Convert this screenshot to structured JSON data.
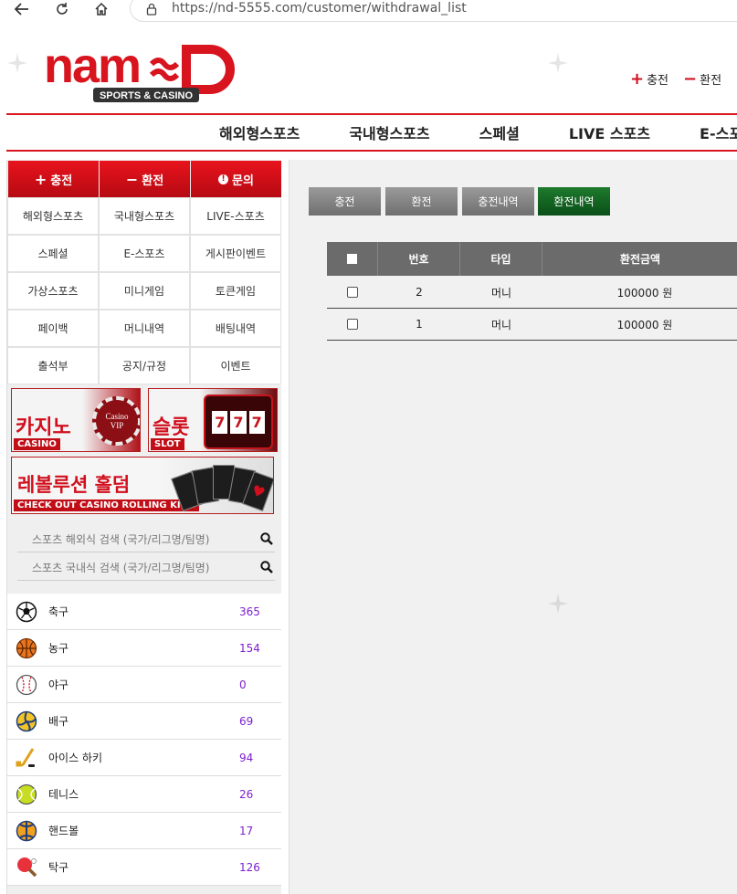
{
  "browser": {
    "url": "https://nd-5555.com/customer/withdrawal_list"
  },
  "header": {
    "logo_text": "nam⌁D",
    "logo_sub": "SPORTS & CASINO",
    "charge_link": "충전",
    "exchange_link": "환전",
    "nav": [
      "해외형스포츠",
      "국내형스포츠",
      "스페셜",
      "LIVE 스포츠",
      "E-스포츠"
    ]
  },
  "sidebar": {
    "quick": [
      {
        "icon": "plus-icon",
        "label": "충전"
      },
      {
        "icon": "minus-icon",
        "label": "환전"
      },
      {
        "icon": "info-icon",
        "label": "문의"
      }
    ],
    "menu": [
      "해외형스포츠",
      "국내형스포츠",
      "LIVE-스포츠",
      "스페셜",
      "E-스포츠",
      "게시판이벤트",
      "가상스포츠",
      "미니게임",
      "토큰게임",
      "페이백",
      "머니내역",
      "배팅내역",
      "출석부",
      "공지/규정",
      "이벤트"
    ],
    "banners": {
      "casino": {
        "title": "카지노",
        "sub": "CASINO",
        "badge": "Casino VIP"
      },
      "slot": {
        "title": "슬롯",
        "sub": "SLOT"
      },
      "holdem": {
        "title": "레볼루션 홀덤",
        "sub": "CHECK OUT CASINO ROLLING KING"
      }
    },
    "search": [
      {
        "placeholder": "스포츠 해외식 검색 (국가/리그명/팀명)"
      },
      {
        "placeholder": "스포츠 국내식 검색 (국가/리그명/팀명)"
      }
    ],
    "sports": [
      {
        "icon": "soccer-icon",
        "name": "축구",
        "count": "365"
      },
      {
        "icon": "basketball-icon",
        "name": "농구",
        "count": "154"
      },
      {
        "icon": "baseball-icon",
        "name": "야구",
        "count": "0"
      },
      {
        "icon": "volleyball-icon",
        "name": "배구",
        "count": "69"
      },
      {
        "icon": "hockey-icon",
        "name": "아이스 하키",
        "count": "94"
      },
      {
        "icon": "tennis-icon",
        "name": "테니스",
        "count": "26"
      },
      {
        "icon": "handball-icon",
        "name": "핸드볼",
        "count": "17"
      },
      {
        "icon": "table-tennis-icon",
        "name": "탁구",
        "count": "126"
      }
    ]
  },
  "content": {
    "tabs": [
      "충전",
      "환전",
      "충전내역",
      "환전내역"
    ],
    "active_tab": "환전내역",
    "table": {
      "headers": [
        "번호",
        "타입",
        "환전금액"
      ],
      "rows": [
        {
          "no": "2",
          "type": "머니",
          "amount": "100000 원"
        },
        {
          "no": "1",
          "type": "머니",
          "amount": "100000 원"
        }
      ]
    }
  },
  "colors": {
    "brand_red": "#d8141f",
    "active_tab": "#0b4f18",
    "count_purple": "#7c1fd1"
  }
}
